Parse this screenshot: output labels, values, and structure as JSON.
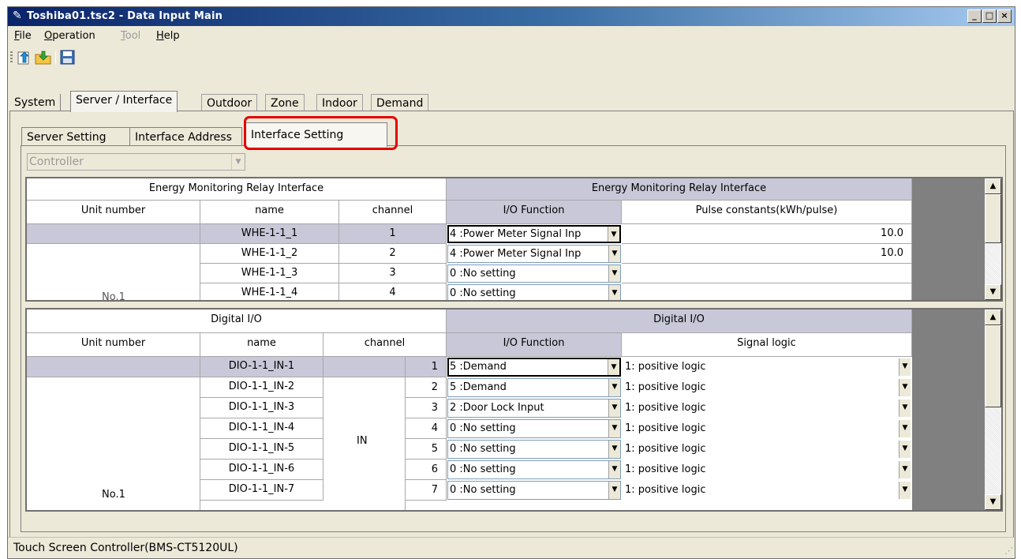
{
  "window": {
    "title": "Toshiba01.tsc2 - Data Input Main",
    "buttons": {
      "minimize": "_",
      "maximize": "□",
      "close": "×"
    }
  },
  "menu": [
    {
      "label": "File",
      "accel": "F",
      "rest": "ile",
      "enabled": true
    },
    {
      "label": "Operation",
      "accel": "O",
      "rest": "peration",
      "enabled": true
    },
    {
      "label": "Tool",
      "accel": "T",
      "rest": "ool",
      "enabled": false
    },
    {
      "label": "Help",
      "accel": "H",
      "rest": "elp",
      "enabled": true
    }
  ],
  "toolbar": {
    "open_icon": "open-folder-arrow-icon",
    "import_icon": "folder-import-icon",
    "save_icon": "floppy-save-icon"
  },
  "top_tabs": [
    "System",
    "Server / Interface",
    "Outdoor",
    "Zone",
    "Indoor",
    "Demand"
  ],
  "sub_tabs": [
    "Server Setting",
    "Interface Address",
    "Interface Setting"
  ],
  "controller_combo": {
    "value": "Controller"
  },
  "emri": {
    "left_header": "Energy Monitoring Relay Interface",
    "right_header": "Energy Monitoring Relay Interface",
    "col_unit": "Unit number",
    "col_name": "name",
    "col_channel": "channel",
    "col_io": "I/O Function",
    "col_pulse": "Pulse constants(kWh/pulse)",
    "unit_label": "No.1",
    "rows": [
      {
        "name": "WHE-1-1_1",
        "channel": "1",
        "io": "4 :Power Meter Signal Inp",
        "pulse": "10.0"
      },
      {
        "name": "WHE-1-1_2",
        "channel": "2",
        "io": "4 :Power Meter Signal Inp",
        "pulse": "10.0"
      },
      {
        "name": "WHE-1-1_3",
        "channel": "3",
        "io": "0 :No setting",
        "pulse": ""
      },
      {
        "name": "WHE-1-1_4",
        "channel": "4",
        "io": "0 :No setting",
        "pulse": ""
      }
    ]
  },
  "dio": {
    "left_header": "Digital I/O",
    "right_header": "Digital I/O",
    "col_unit": "Unit number",
    "col_name": "name",
    "col_channel": "channel",
    "col_io": "I/O Function",
    "col_logic": "Signal logic",
    "unit_label": "No.1",
    "channel_group": "IN",
    "rows": [
      {
        "name": "DIO-1-1_IN-1",
        "channel": "1",
        "io": "5 :Demand",
        "logic": "1: positive logic"
      },
      {
        "name": "DIO-1-1_IN-2",
        "channel": "2",
        "io": "5 :Demand",
        "logic": "1: positive logic"
      },
      {
        "name": "DIO-1-1_IN-3",
        "channel": "3",
        "io": "2 :Door Lock Input",
        "logic": "1: positive logic"
      },
      {
        "name": "DIO-1-1_IN-4",
        "channel": "4",
        "io": "0 :No setting",
        "logic": "1: positive logic"
      },
      {
        "name": "DIO-1-1_IN-5",
        "channel": "5",
        "io": "0 :No setting",
        "logic": "1: positive logic"
      },
      {
        "name": "DIO-1-1_IN-6",
        "channel": "6",
        "io": "0 :No setting",
        "logic": "1: positive logic"
      },
      {
        "name": "DIO-1-1_IN-7",
        "channel": "7",
        "io": "0 :No setting",
        "logic": "1: positive logic"
      }
    ]
  },
  "status": {
    "text": "Touch Screen Controller(BMS-CT5120UL)"
  }
}
